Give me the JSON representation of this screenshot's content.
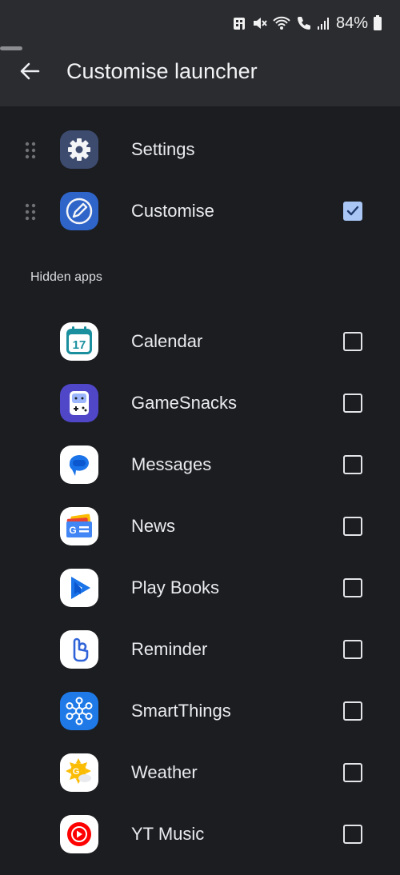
{
  "status_bar": {
    "battery_percent": "84%",
    "icons": [
      "building-icon",
      "mute-icon",
      "wifi-calling-icon",
      "call-icon",
      "signal-icon",
      "battery-icon"
    ]
  },
  "header": {
    "title": "Customise launcher",
    "back_icon": "arrow-left-icon"
  },
  "pinned_apps": [
    {
      "label": "Settings",
      "icon": "settings-icon",
      "checkbox": null
    },
    {
      "label": "Customise",
      "icon": "customise-icon",
      "checkbox": true
    }
  ],
  "hidden_section": {
    "title": "Hidden apps",
    "apps": [
      {
        "label": "Calendar",
        "icon": "calendar-icon",
        "icon_text": "17",
        "checked": false
      },
      {
        "label": "GameSnacks",
        "icon": "gamesnacks-icon",
        "checked": false
      },
      {
        "label": "Messages",
        "icon": "messages-icon",
        "checked": false
      },
      {
        "label": "News",
        "icon": "news-icon",
        "icon_text": "G",
        "checked": false
      },
      {
        "label": "Play Books",
        "icon": "play-books-icon",
        "checked": false
      },
      {
        "label": "Reminder",
        "icon": "reminder-icon",
        "checked": false
      },
      {
        "label": "SmartThings",
        "icon": "smartthings-icon",
        "checked": false
      },
      {
        "label": "Weather",
        "icon": "weather-icon",
        "icon_text": "G",
        "checked": false
      },
      {
        "label": "YT Music",
        "icon": "yt-music-icon",
        "checked": false
      }
    ]
  },
  "colors": {
    "background": "#1b1d20",
    "header_background": "#2a2c30",
    "checkbox_checked": "#a9c6f5"
  }
}
